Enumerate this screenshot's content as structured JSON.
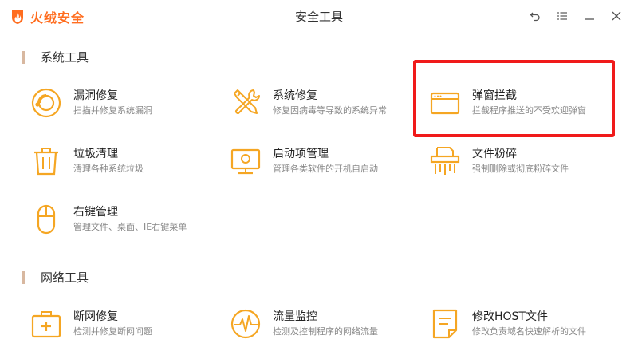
{
  "app": {
    "logo_text": "火绒安全",
    "window_title": "安全工具"
  },
  "sections": {
    "system": {
      "title": "系统工具"
    },
    "network": {
      "title": "网络工具"
    }
  },
  "tools": {
    "leak_repair": {
      "name": "漏洞修复",
      "desc": "扫描并修复系统漏洞",
      "icon": "lifebuoy-icon"
    },
    "system_repair": {
      "name": "系统修复",
      "desc": "修复因病毒等导致的系统异常",
      "icon": "wrench-screwdriver-icon"
    },
    "popup_block": {
      "name": "弹窗拦截",
      "desc": "拦截程序推送的不受欢迎弹窗",
      "icon": "browser-window-icon"
    },
    "garbage_clean": {
      "name": "垃圾清理",
      "desc": "清理各种系统垃圾",
      "icon": "trash-icon"
    },
    "startup_manage": {
      "name": "启动项管理",
      "desc": "管理各类软件的开机自启动",
      "icon": "monitor-icon"
    },
    "file_shred": {
      "name": "文件粉碎",
      "desc": "强制删除或彻底粉碎文件",
      "icon": "shredder-icon"
    },
    "right_click": {
      "name": "右键管理",
      "desc": "管理文件、桌面、IE右键菜单",
      "icon": "mouse-icon"
    },
    "net_repair": {
      "name": "断网修复",
      "desc": "检测并修复断网问题",
      "icon": "first-aid-kit-icon"
    },
    "traffic_monitor": {
      "name": "流量监控",
      "desc": "检测及控制程序的网络流量",
      "icon": "pulse-gauge-icon"
    },
    "hosts_edit": {
      "name": "修改HOST文件",
      "desc": "修改负责域名快速解析的文件",
      "icon": "document-icon"
    }
  },
  "colors": {
    "accent": "#f5a623",
    "brand": "#ff6d1f",
    "highlight": "#f01a1a"
  }
}
